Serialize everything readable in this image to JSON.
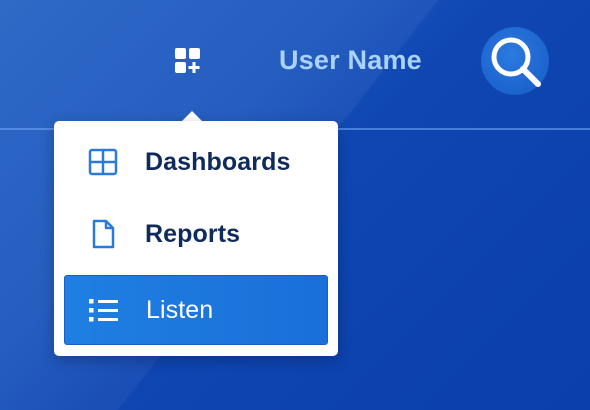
{
  "header": {
    "user_name": "User Name",
    "apps_icon": "grid-plus-icon",
    "search_icon": "search-icon"
  },
  "menu": {
    "items": [
      {
        "label": "Dashboards",
        "icon": "dashboard-grid-icon",
        "active": false
      },
      {
        "label": "Reports",
        "icon": "document-icon",
        "active": false
      },
      {
        "label": "Listen",
        "icon": "list-icon",
        "active": true
      }
    ]
  },
  "colors": {
    "background": "#0d43b0",
    "accent": "#1f7fe3",
    "user_name_text": "#a9d2ff",
    "menu_text": "#0f2a5c",
    "icon_blue": "#2a7bd8"
  }
}
